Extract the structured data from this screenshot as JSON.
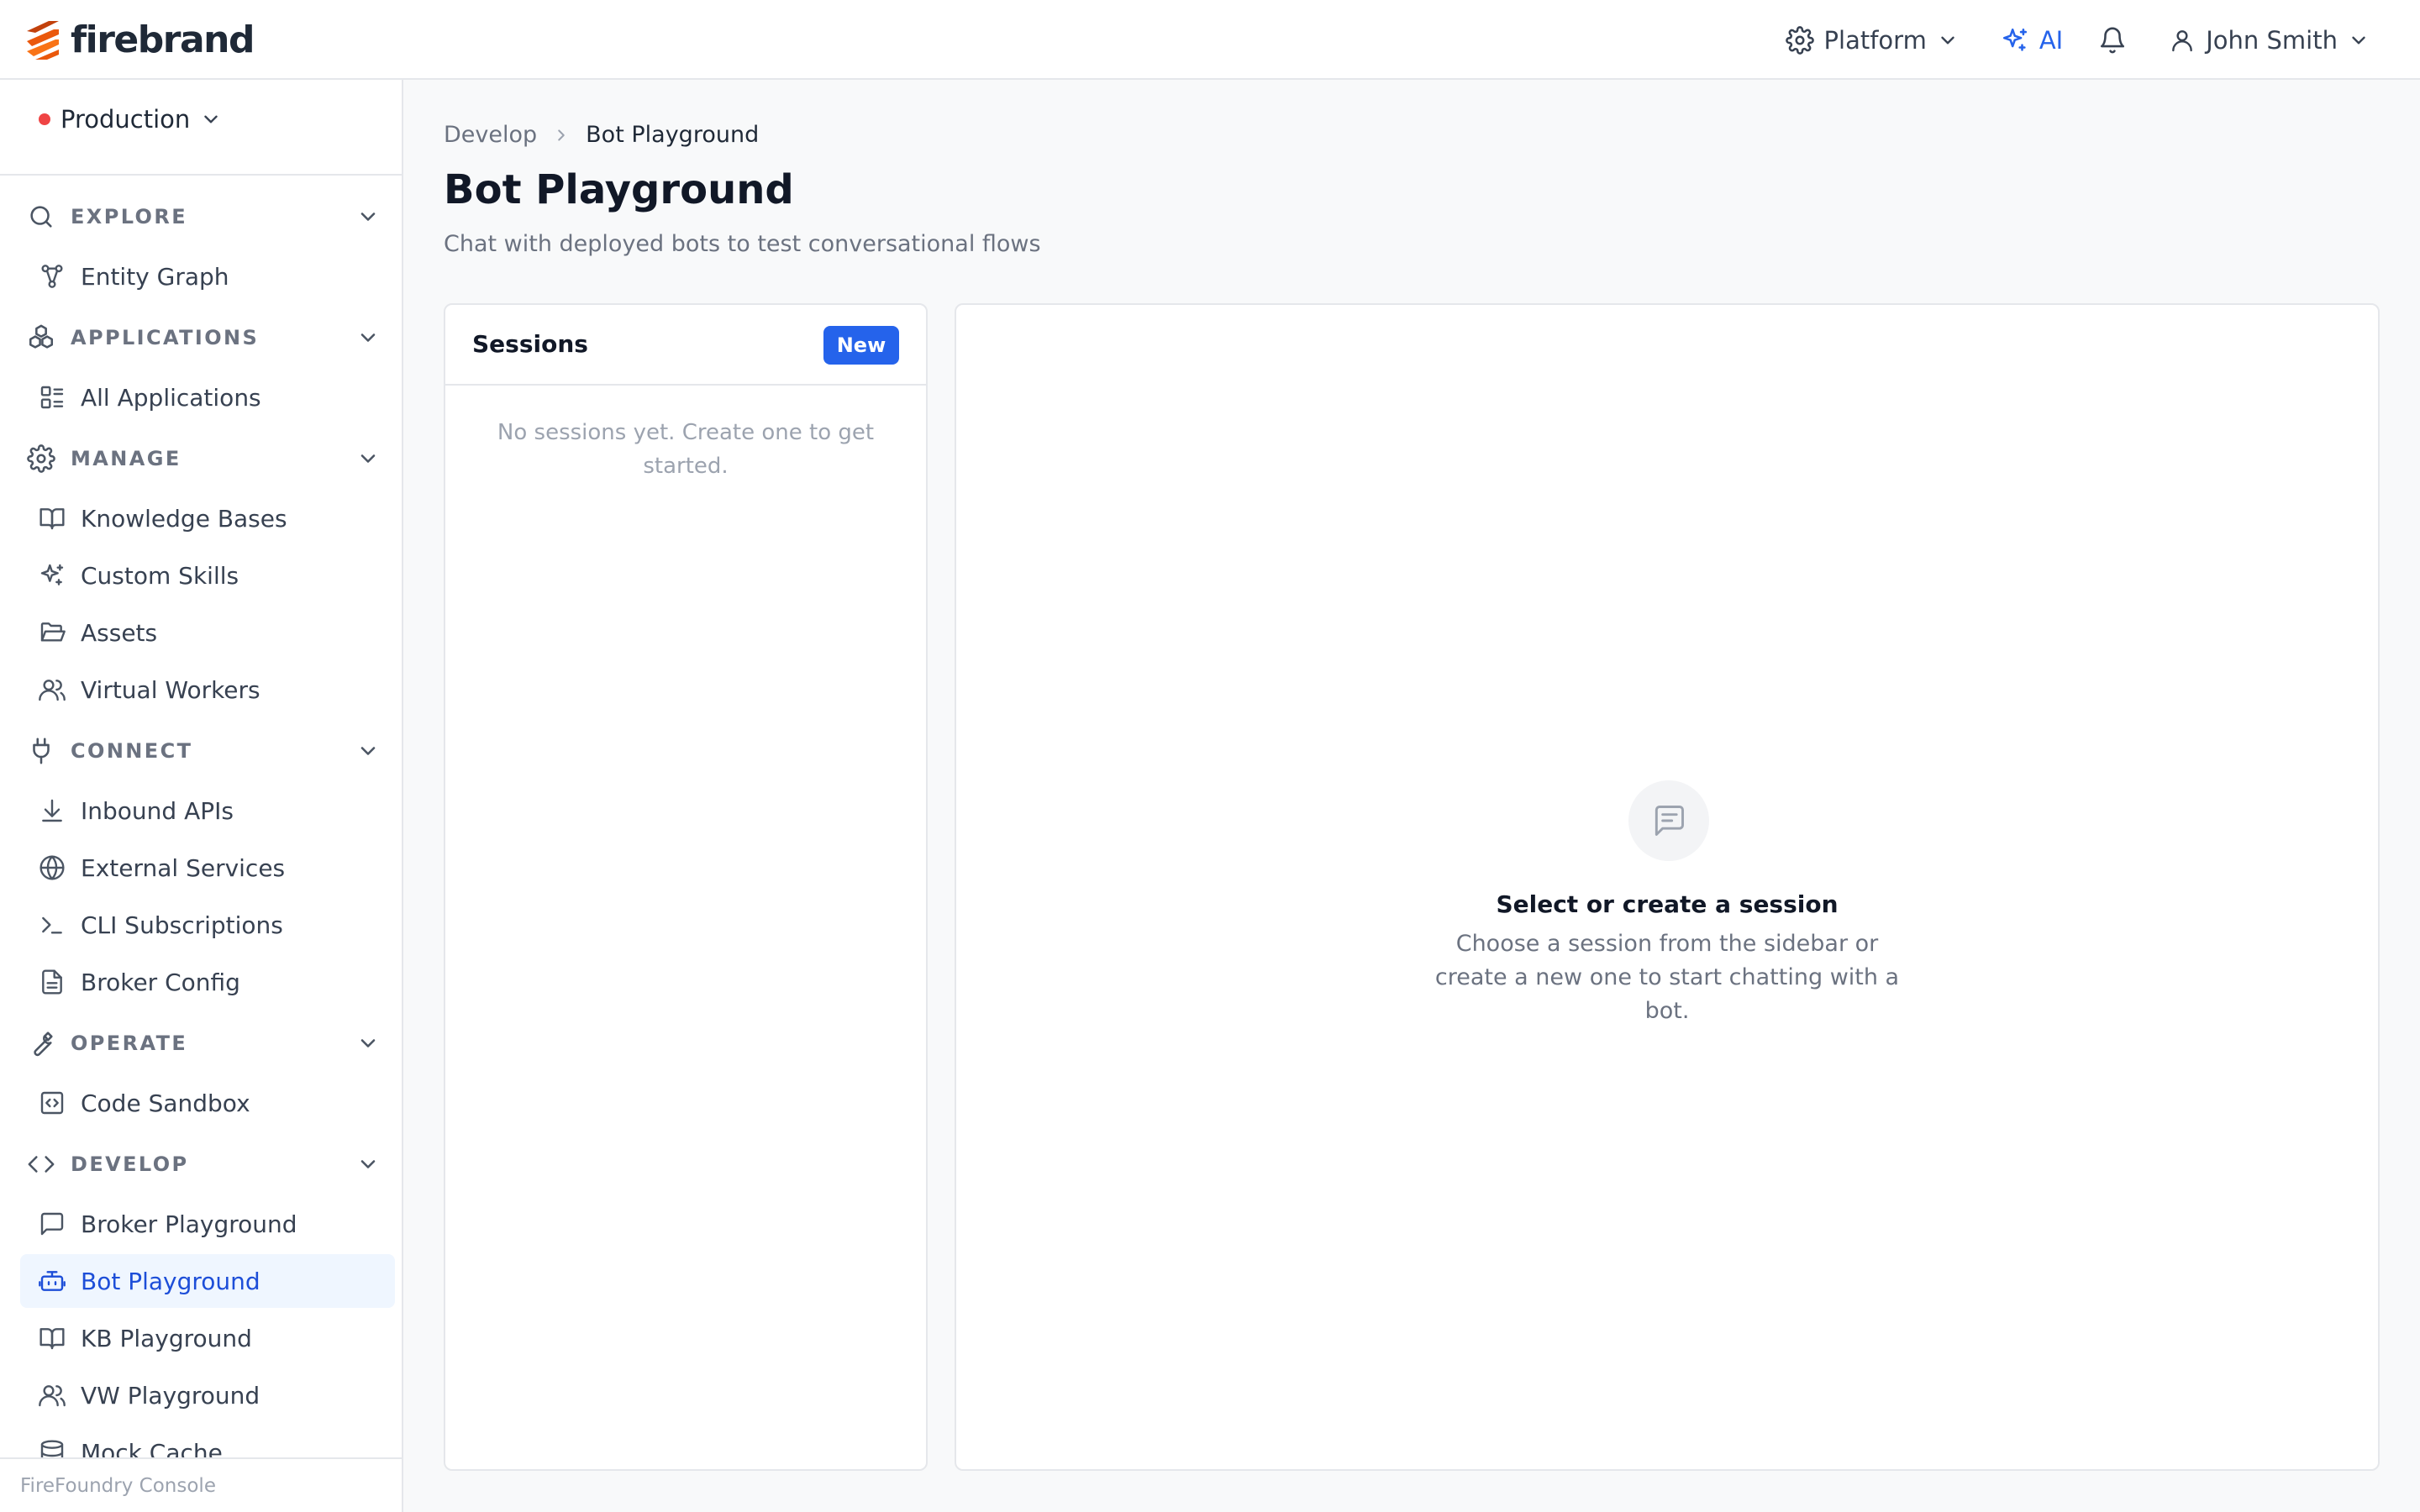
{
  "brand": {
    "name": "firebrand"
  },
  "topbar": {
    "platform_label": "Platform",
    "ai_label": "AI",
    "user_name": "John Smith"
  },
  "sidebar": {
    "environment": "Production",
    "sections": {
      "explore": {
        "label": "EXPLORE",
        "items": [
          "Entity Graph"
        ]
      },
      "applications": {
        "label": "APPLICATIONS",
        "items": [
          "All Applications"
        ]
      },
      "manage": {
        "label": "MANAGE",
        "items": [
          "Knowledge Bases",
          "Custom Skills",
          "Assets",
          "Virtual Workers"
        ]
      },
      "connect": {
        "label": "CONNECT",
        "items": [
          "Inbound APIs",
          "External Services",
          "CLI Subscriptions",
          "Broker Config"
        ]
      },
      "operate": {
        "label": "OPERATE",
        "items": [
          "Code Sandbox"
        ]
      },
      "develop": {
        "label": "DEVELOP",
        "items": [
          "Broker Playground",
          "Bot Playground",
          "KB Playground",
          "VW Playground",
          "Mock Cache"
        ]
      }
    },
    "active_item": "Bot Playground",
    "footer": "FireFoundry Console"
  },
  "breadcrumb": {
    "parent": "Develop",
    "current": "Bot Playground"
  },
  "page": {
    "title": "Bot Playground",
    "subtitle": "Chat with deployed bots to test conversational flows"
  },
  "sessions": {
    "title": "Sessions",
    "new_label": "New",
    "empty_text": "No sessions yet. Create one to get started."
  },
  "chat": {
    "empty_title": "Select or create a session",
    "empty_text": "Choose a session from the sidebar or create a new one to start chatting with a bot."
  },
  "colors": {
    "accent": "#2563eb",
    "environment_dot": "#ef4444",
    "brand": "#e8622a"
  }
}
